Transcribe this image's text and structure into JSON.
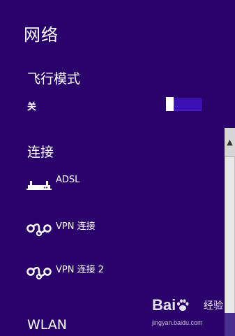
{
  "panel": {
    "title": "网络",
    "background": "#2a006b"
  },
  "airplane_mode": {
    "title": "飞行模式",
    "state_label": "关",
    "enabled": false
  },
  "connections": {
    "title": "连接",
    "items": [
      {
        "icon": "router-icon",
        "label": "ADSL"
      },
      {
        "icon": "vpn-icon",
        "label": "VPN 连接"
      },
      {
        "icon": "vpn-icon",
        "label": "VPN 连接 2"
      }
    ]
  },
  "wlan": {
    "title": "WLAN"
  },
  "watermark": {
    "logo_left": "Bai",
    "logo_right": "经验",
    "url": "jingyan.baidu.com"
  }
}
